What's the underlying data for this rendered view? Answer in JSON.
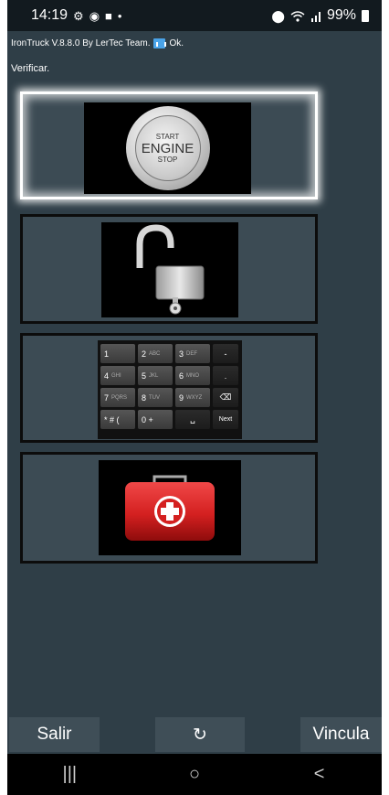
{
  "status_bar": {
    "time": "14:19",
    "left_icons": [
      "settings-icon",
      "shield-icon",
      "camera-icon",
      "dot-icon"
    ],
    "right_icons": [
      "location-icon",
      "wifi-icon",
      "signal-icon",
      "battery-icon"
    ],
    "battery": "99%"
  },
  "app": {
    "info": "IronTruck  V.8.8.0   By LerTec Team.",
    "link_status": "Ok.",
    "status_message": "Verificar."
  },
  "tiles": [
    {
      "name": "start-engine",
      "selected": true,
      "text": [
        "START",
        "ENGINE",
        "STOP"
      ]
    },
    {
      "name": "unlock",
      "selected": false
    },
    {
      "name": "keypad",
      "selected": false,
      "keys": [
        {
          "main": "1",
          "sub": ""
        },
        {
          "main": "2",
          "sub": "ABC"
        },
        {
          "main": "3",
          "sub": "DEF"
        },
        {
          "main": "-",
          "sub": ""
        },
        {
          "main": "4",
          "sub": "GHI"
        },
        {
          "main": "5",
          "sub": "JKL"
        },
        {
          "main": "6",
          "sub": "MNO"
        },
        {
          "main": ".",
          "sub": ""
        },
        {
          "main": "7",
          "sub": "PQRS"
        },
        {
          "main": "8",
          "sub": "TUV"
        },
        {
          "main": "9",
          "sub": "WXYZ"
        },
        {
          "main": "⌫",
          "sub": ""
        },
        {
          "main": "* # (",
          "sub": ""
        },
        {
          "main": "0 +",
          "sub": ""
        },
        {
          "main": "␣",
          "sub": ""
        },
        {
          "main": "Next",
          "sub": ""
        }
      ]
    },
    {
      "name": "first-aid",
      "selected": false
    }
  ],
  "buttons": {
    "exit": "Salir",
    "refresh": "↻",
    "link": "Vincula"
  },
  "nav": {
    "recent": "|||",
    "home": "○",
    "back": "<"
  },
  "colors": {
    "background": "#2f3e47",
    "tile": "#3c4b54",
    "first_aid_red": "#d42020"
  }
}
